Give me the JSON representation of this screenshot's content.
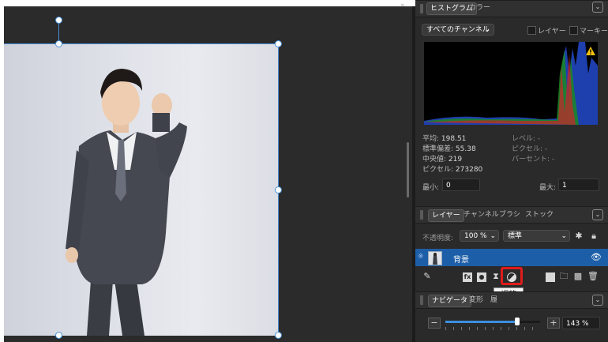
{
  "histogram_panel": {
    "tabs": [
      "ヒストグラム",
      "カラー"
    ],
    "channel_dropdown": "すべてのチャンネル",
    "layer_checkbox": "レイヤー",
    "marquee_checkbox": "マーキー",
    "warning_icon": "warning-triangle",
    "stats": {
      "mean": {
        "label": "平均:",
        "value": "198.51"
      },
      "stddev": {
        "label": "標準偏差:",
        "value": "55.38"
      },
      "median": {
        "label": "中央値:",
        "value": "219"
      },
      "pixels": {
        "label": "ピクセル:",
        "value": "273280"
      },
      "level": {
        "label": "レベル:",
        "value": "-"
      },
      "pixel_sel": {
        "label": "ピクセル:",
        "value": "-"
      },
      "percent": {
        "label": "パーセント:",
        "value": "-"
      }
    },
    "min_label": "最小:",
    "min_value": "0",
    "max_label": "最大:",
    "max_value": "1"
  },
  "layers_panel": {
    "tabs": [
      "レイヤー",
      "チャンネル",
      "ブラシ",
      "ストック"
    ],
    "opacity_label": "不透明度:",
    "opacity_value": "100 %",
    "blend_mode": "標準",
    "layer_name": "背景",
    "tooltip": "調整",
    "toolbar_icons": [
      "edit-icon",
      "fx-icon",
      "mask-icon",
      "adjustment-icon",
      "group-icon",
      "folder-icon",
      "pattern-icon",
      "trash-icon"
    ]
  },
  "navigator_panel": {
    "tabs": [
      "ナビゲータ",
      "変形",
      "履"
    ],
    "zoom_value": "143 %",
    "zoom_level": 0.76
  },
  "colors": {
    "selection": "#4a90d9",
    "layer_selected": "#1d5ea8",
    "highlight": "#e01b1b",
    "slider": "#3b8fe0"
  }
}
